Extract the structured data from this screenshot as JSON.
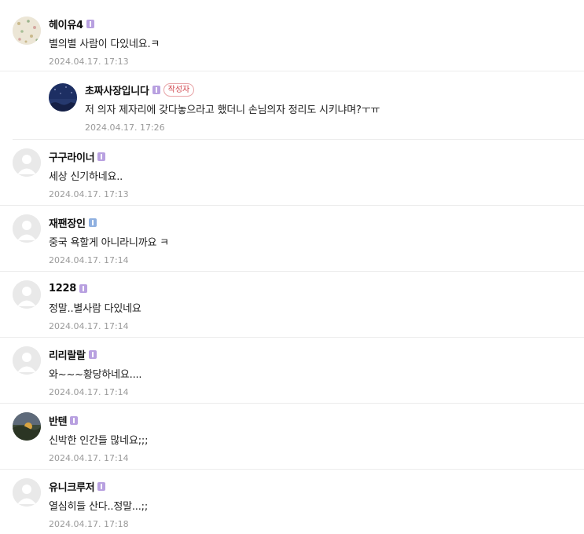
{
  "comments": [
    {
      "nickname": "헤이유4",
      "level": "1",
      "text": "별의별 사람이 다있네요.ㅋ",
      "date": "2024.04.17. 17:13",
      "avatar": "floral-pattern-avatar"
    },
    {
      "nickname": "초짜사장입니다",
      "level": "1",
      "author_badge": "작성자",
      "text": "저 의자 제자리에 갖다놓으라고 했더니 손님의자 정리도 시키냐며?ㅜㅠ",
      "date": "2024.04.17. 17:26",
      "avatar": "night-sky-avatar"
    },
    {
      "nickname": "구구라이너",
      "level": "1",
      "text": "세상 신기하네요..",
      "date": "2024.04.17. 17:13",
      "avatar": "default-avatar"
    },
    {
      "nickname": "재팬장인",
      "level": "2",
      "text": "중국 욕할게 아니라니까요 ㅋ",
      "date": "2024.04.17. 17:14",
      "avatar": "default-avatar"
    },
    {
      "nickname": "1228",
      "level": "1",
      "text": "정말..별사람 다있네요",
      "date": "2024.04.17. 17:14",
      "avatar": "default-avatar"
    },
    {
      "nickname": "리리랄랄",
      "level": "1",
      "text": "와~~~황당하네요....",
      "date": "2024.04.17. 17:14",
      "avatar": "default-avatar"
    },
    {
      "nickname": "반텐",
      "level": "1",
      "text": "신박한 인간들 많네요;;;",
      "date": "2024.04.17. 17:14",
      "avatar": "sunset-avatar"
    },
    {
      "nickname": "유니크루저",
      "level": "1",
      "text": "열심히들 산다..정말...;;",
      "date": "2024.04.17. 17:18",
      "avatar": "default-avatar"
    }
  ]
}
